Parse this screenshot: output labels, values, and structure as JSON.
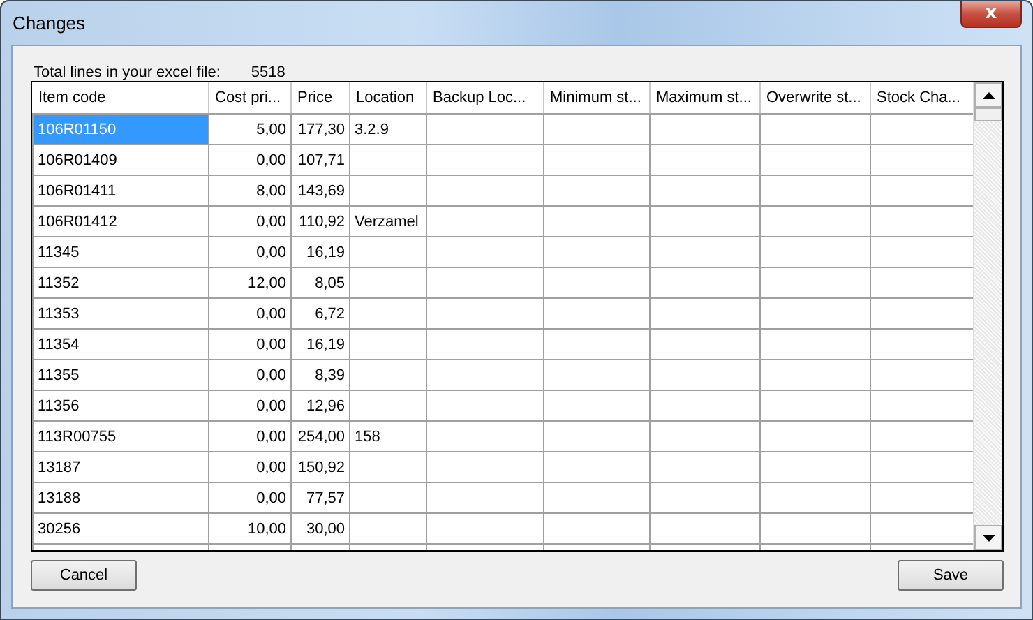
{
  "window": {
    "title": "Changes",
    "close_label": "x"
  },
  "summary": {
    "label": "Total lines in your excel file:",
    "value": "5518"
  },
  "table": {
    "columns": [
      {
        "label": "Item code",
        "kind": "text"
      },
      {
        "label": "Cost pri...",
        "kind": "number"
      },
      {
        "label": "Price",
        "kind": "number"
      },
      {
        "label": "Location",
        "kind": "text"
      },
      {
        "label": "Backup Loc...",
        "kind": "text"
      },
      {
        "label": "Minimum st...",
        "kind": "text"
      },
      {
        "label": "Maximum st...",
        "kind": "text"
      },
      {
        "label": "Overwrite st...",
        "kind": "text"
      },
      {
        "label": "Stock Cha...",
        "kind": "text"
      }
    ],
    "rows": [
      {
        "selected": true,
        "cells": [
          "106R01150",
          "5,00",
          "177,30",
          "3.2.9"
        ]
      },
      {
        "selected": false,
        "cells": [
          "106R01409",
          "0,00",
          "107,71",
          ""
        ]
      },
      {
        "selected": false,
        "cells": [
          "106R01411",
          "8,00",
          "143,69",
          ""
        ]
      },
      {
        "selected": false,
        "cells": [
          "106R01412",
          "0,00",
          "110,92",
          "Verzamel"
        ]
      },
      {
        "selected": false,
        "cells": [
          "11345",
          "0,00",
          "16,19",
          ""
        ]
      },
      {
        "selected": false,
        "cells": [
          "11352",
          "12,00",
          "8,05",
          ""
        ]
      },
      {
        "selected": false,
        "cells": [
          "11353",
          "0,00",
          "6,72",
          ""
        ]
      },
      {
        "selected": false,
        "cells": [
          "11354",
          "0,00",
          "16,19",
          ""
        ]
      },
      {
        "selected": false,
        "cells": [
          "11355",
          "0,00",
          "8,39",
          ""
        ]
      },
      {
        "selected": false,
        "cells": [
          "11356",
          "0,00",
          "12,96",
          ""
        ]
      },
      {
        "selected": false,
        "cells": [
          "113R00755",
          "0,00",
          "254,00",
          "158"
        ]
      },
      {
        "selected": false,
        "cells": [
          "13187",
          "0,00",
          "150,92",
          ""
        ]
      },
      {
        "selected": false,
        "cells": [
          "13188",
          "0,00",
          "77,57",
          ""
        ]
      },
      {
        "selected": false,
        "cells": [
          "30256",
          "10,00",
          "30,00",
          ""
        ]
      }
    ]
  },
  "buttons": [
    {
      "label": "Cancel"
    },
    {
      "label": "Save"
    }
  ]
}
